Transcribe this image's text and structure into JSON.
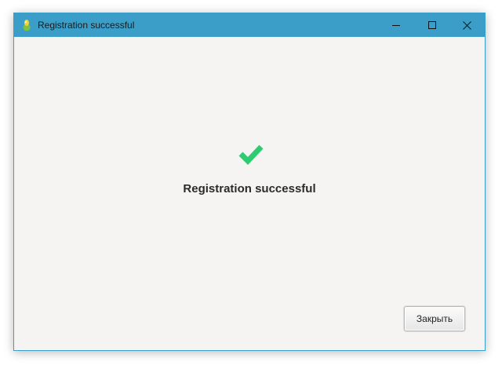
{
  "window": {
    "title": "Registration successful",
    "accent_color": "#3a9ec8",
    "icon": "app-leaf-icon"
  },
  "controls": {
    "minimize_icon": "minimize-icon",
    "maximize_icon": "maximize-icon",
    "close_icon": "close-icon"
  },
  "content": {
    "status_icon": "checkmark-icon",
    "status_color": "#2ecc71",
    "message": "Registration successful",
    "close_button_label": "Закрыть"
  }
}
